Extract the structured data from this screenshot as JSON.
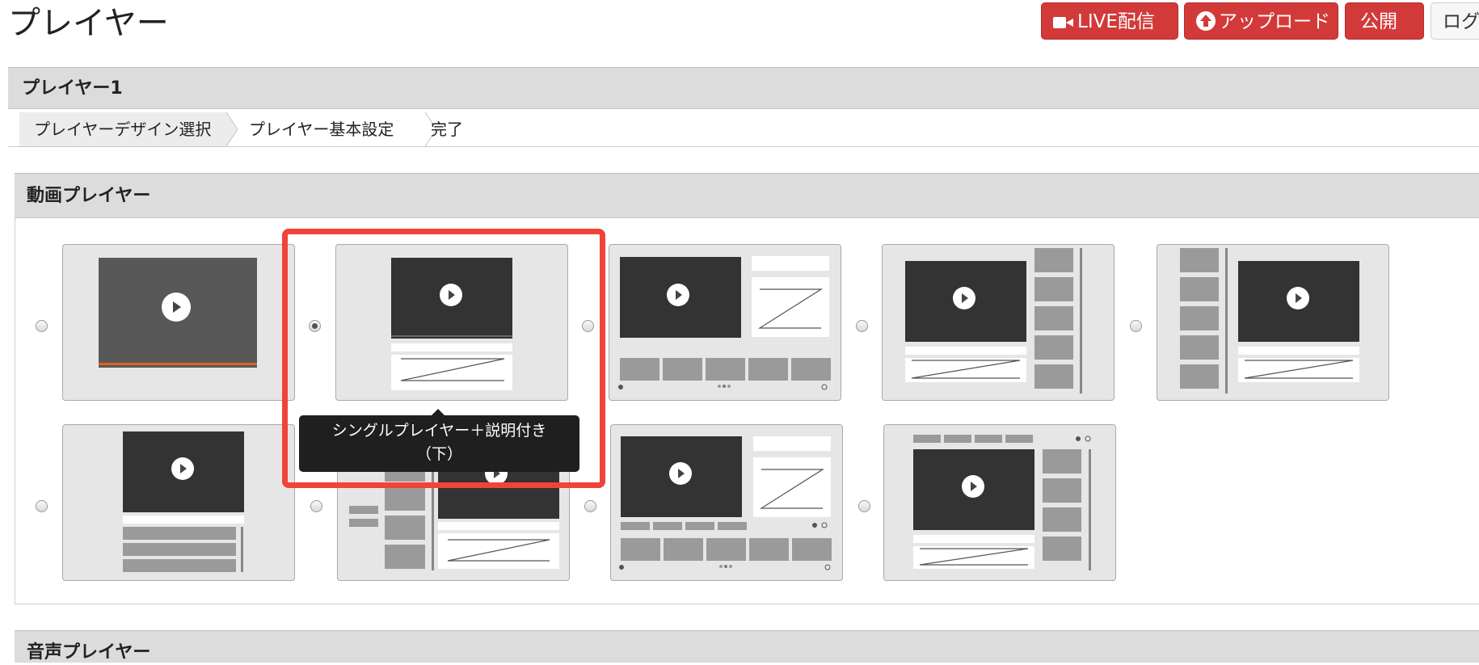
{
  "page": {
    "title": "プレイヤー"
  },
  "header_buttons": {
    "live": "LIVE配信",
    "upload": "アップロード",
    "publish": "公開",
    "logout_partial": "ログ"
  },
  "player_name": "プレイヤー1",
  "steps": [
    "プレイヤーデザイン選択",
    "プレイヤー基本設定",
    "完了"
  ],
  "video_section": {
    "title": "動画プレイヤー",
    "selected_index": 1
  },
  "tooltip": {
    "line1": "シングルプレイヤー＋説明付き",
    "line2": "（下）"
  },
  "audio_section": {
    "title": "音声プレイヤー"
  },
  "colors": {
    "accent_red": "#d23a3a",
    "highlight": "#f04438"
  },
  "icons": [
    "video-camera-icon",
    "upload-icon",
    "play-icon"
  ]
}
